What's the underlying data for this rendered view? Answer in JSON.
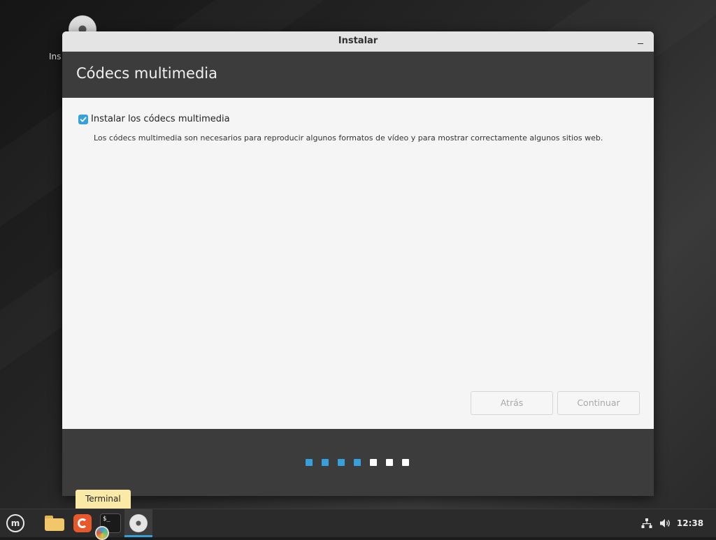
{
  "desktop": {
    "icon_label": "Ins"
  },
  "window": {
    "title": "Instalar",
    "page_title": "Códecs multimedia",
    "checkbox_label": "Instalar los códecs multimedia",
    "checkbox_checked": true,
    "description": "Los códecs multimedia son necesarios para reproducir algunos formatos de vídeo y para mostrar correctamente algunos sitios web.",
    "back_label": "Atrás",
    "next_label": "Continuar",
    "progress": {
      "total_steps": 7,
      "completed_steps": 4,
      "completed_color": "#35a0dc",
      "pending_color": "#ffffff"
    }
  },
  "taskbar": {
    "menu_icon": "linux-mint-menu-icon",
    "apps": [
      {
        "name": "files",
        "icon": "folder-icon"
      },
      {
        "name": "firefox",
        "icon": "firefox-icon"
      },
      {
        "name": "terminal",
        "icon": "terminal-icon",
        "glyph": "$_"
      },
      {
        "name": "installer",
        "icon": "disc-icon",
        "active": true
      }
    ],
    "tooltip": "Terminal",
    "tray": [
      "network-icon",
      "volume-icon"
    ],
    "clock": "12:38"
  },
  "colors": {
    "accent": "#35a0dc",
    "header_bg": "#3c3c3c",
    "content_bg": "#f5f5f5",
    "tooltip_bg": "#fbe9a6"
  }
}
